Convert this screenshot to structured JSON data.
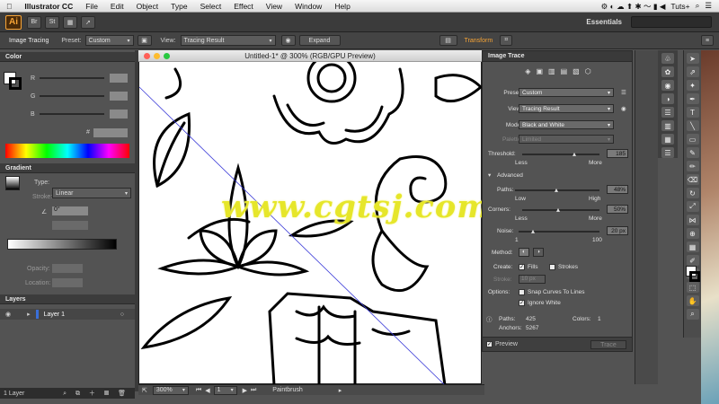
{
  "menubar": {
    "app_name": "Illustrator CC",
    "items": [
      "File",
      "Edit",
      "Object",
      "Type",
      "Select",
      "Effect",
      "View",
      "Window",
      "Help"
    ],
    "account": "Tuts+"
  },
  "appbar": {
    "logo": "Ai",
    "bridge": "Br",
    "stock": "St",
    "workspace": "Essentials"
  },
  "control_bar": {
    "label": "Image Tracing",
    "preset_label": "Preset:",
    "preset_value": "Custom",
    "view_label": "View:",
    "view_value": "Tracing Result",
    "expand_label": "Expand",
    "transform_label": "Transform"
  },
  "color_panel": {
    "title": "Color",
    "channels": [
      "R",
      "G",
      "B"
    ],
    "hex_label": "#"
  },
  "gradient_panel": {
    "title": "Gradient",
    "type_label": "Type:",
    "type_value": "Linear",
    "stroke_label": "Stroke:",
    "angle_value": "0°",
    "opacity_label": "Opacity:",
    "location_label": "Location:"
  },
  "layers_panel": {
    "title": "Layers",
    "layer_name": "Layer 1",
    "footer": "1 Layer"
  },
  "document": {
    "title": "Untitled-1* @ 300% (RGB/GPU Preview)",
    "zoom": "300%",
    "page": "1",
    "tool": "Paintbrush"
  },
  "image_trace": {
    "title": "Image Trace",
    "preset_label": "Preset:",
    "preset_value": "Custom",
    "view_label": "View:",
    "view_value": "Tracing Result",
    "mode_label": "Mode:",
    "mode_value": "Black and White",
    "palette_label": "Palette:",
    "palette_value": "Limited",
    "threshold_label": "Threshold:",
    "threshold_value": "185",
    "less": "Less",
    "more": "More",
    "advanced": "Advanced",
    "paths_label": "Paths:",
    "paths_value": "48%",
    "low": "Low",
    "high": "High",
    "corners_label": "Corners:",
    "corners_value": "50%",
    "noise_label": "Noise:",
    "noise_value": "20 px",
    "noise_min": "1",
    "noise_max": "100",
    "method_label": "Method:",
    "create_label": "Create:",
    "fills_label": "Fills",
    "strokes_label": "Strokes",
    "stroke_label": "Stroke:",
    "stroke_value": "10 px",
    "options_label": "Options:",
    "snap_label": "Snap Curves To Lines",
    "ignore_white_label": "Ignore White",
    "stats_paths_label": "Paths:",
    "stats_paths_value": "425",
    "stats_colors_label": "Colors:",
    "stats_colors_value": "1",
    "stats_anchors_label": "Anchors:",
    "stats_anchors_value": "5267",
    "preview_label": "Preview",
    "trace_label": "Trace",
    "fills_checked": true,
    "strokes_checked": false,
    "snap_checked": false,
    "ignore_white_checked": true,
    "preview_checked": true
  },
  "watermark": "www.cgtsj.com",
  "colors": {
    "ui_dark": "#3b3b3b",
    "ui_mid": "#535353",
    "accent_orange": "#f7a436",
    "watermark": "#e6e62a"
  }
}
